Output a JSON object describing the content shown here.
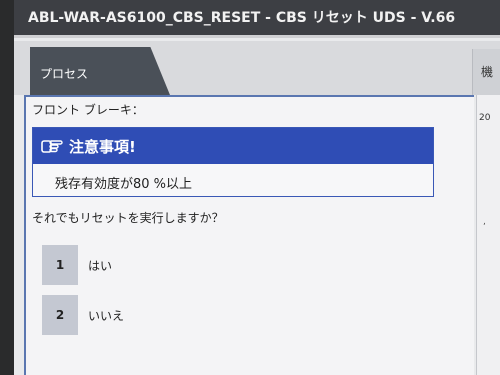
{
  "window": {
    "title": "ABL-WAR-AS6100_CBS_RESET - CBS リセット UDS - V.66"
  },
  "tabs": {
    "process_label": "プロセス",
    "right_label": "機"
  },
  "side": {
    "timestamp": "20",
    "mark": ","
  },
  "panel": {
    "heading": "フロント ブレーキ：",
    "notice_title": "注意事項!",
    "notice_body": "残存有効度が80 %以上",
    "question": "それでもリセットを実行しますか？"
  },
  "options": [
    {
      "number": "1",
      "label": "はい"
    },
    {
      "number": "2",
      "label": "いいえ"
    }
  ],
  "icons": {
    "notice": "pointing-hand-icon"
  }
}
